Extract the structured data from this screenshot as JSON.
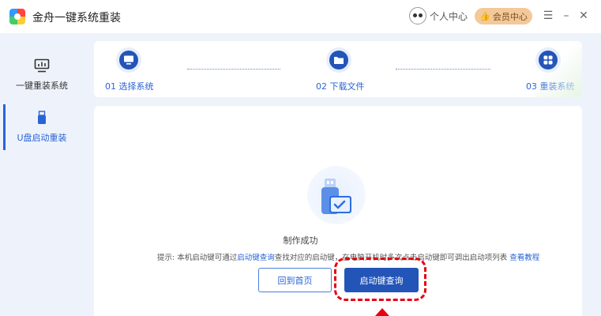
{
  "window": {
    "title": "金舟一键系统重装",
    "user_center": "个人中心",
    "vip_center": "会员中心",
    "menu_glyph": "☰",
    "minimize_glyph": "–",
    "close_glyph": "✕"
  },
  "sidebar": {
    "items": [
      {
        "label": "一键重装系统",
        "icon": "monitor-chart-icon",
        "active": false
      },
      {
        "label": "U盘启动重装",
        "icon": "usb-drive-icon",
        "active": true
      }
    ]
  },
  "steps": [
    {
      "label": "01 选择系统",
      "icon": "monitor-icon"
    },
    {
      "label": "02 下载文件",
      "icon": "folder-icon"
    },
    {
      "label": "03 重装系统",
      "icon": "windows-grid-icon"
    }
  ],
  "main": {
    "status": "制作成功",
    "hint": {
      "prefix": "提示: 本机启动键可通过",
      "link1": "启动键查询",
      "middle": "查找对应的启动键，在电脑开机时多次点击启动键即可调出启动项列表",
      "link2": "查看教程"
    },
    "home_button": "回到首页",
    "query_button": "启动键查询"
  },
  "colors": {
    "accent": "#2354b8",
    "link": "#2a63d8",
    "highlight": "#e60012",
    "vip": "#f3c99a"
  }
}
